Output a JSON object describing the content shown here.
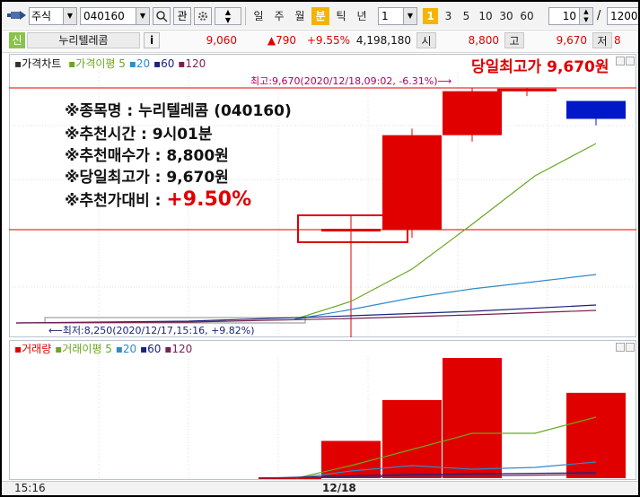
{
  "toolbar": {
    "market_select": "주식",
    "code_value": "040160",
    "fav_label": "관",
    "periods": [
      "일",
      "주",
      "월",
      "분",
      "틱",
      "년"
    ],
    "active_period": "분",
    "interval_value": "1",
    "interval_badge": "1",
    "quick_intervals": [
      "3",
      "5",
      "10",
      "30",
      "60"
    ],
    "count_value": "10",
    "slash": "/",
    "total_value": "1200"
  },
  "quote": {
    "credit_tag": "신",
    "stock_name": "누리텔레콤",
    "info_label": "i",
    "price": "9,060",
    "change": "▲790",
    "change_rate": "+9.55%",
    "volume": "4,198,180",
    "open_label": "시",
    "open_value": "8,800",
    "high_label": "고",
    "high_value": "9,670",
    "low_label": "저",
    "low_value": "8"
  },
  "price_panel": {
    "legend": {
      "title": "가격차트",
      "ma_label": "가격이평",
      "ma_periods": [
        "5",
        "20",
        "60",
        "120"
      ]
    },
    "max_note": "최고:9,670(2020/12/18,09:02, -6.31%)⟶",
    "min_note": "⟵최저:8,250(2020/12/17,15:16, +9.82%)",
    "headline": "당일최고가 9,670원",
    "annotations": [
      {
        "label": "※종목명 : ",
        "value": "누리텔레콤 (040160)"
      },
      {
        "label": "※추천시간 : ",
        "value": "9시01분"
      },
      {
        "label": "※추천매수가 : ",
        "value": "8,800원"
      },
      {
        "label": "※당일최고가 : ",
        "value": "9,670원"
      },
      {
        "label": "※추천가대비 : ",
        "value": "+9.50%"
      }
    ]
  },
  "volume_panel": {
    "legend": {
      "title": "거래량",
      "ma_label": "거래이평",
      "ma_periods": [
        "5",
        "20",
        "60",
        "120"
      ]
    }
  },
  "x_axis": {
    "labels": [
      "15:16",
      "12/18"
    ]
  },
  "chart_data": {
    "type": "candlestick",
    "candles": [
      {
        "open": 8800,
        "high": 8800,
        "low": 8800,
        "close": 8800,
        "direction": "flat"
      },
      {
        "open": 8800,
        "high": 9420,
        "low": 8750,
        "close": 9380,
        "direction": "up"
      },
      {
        "open": 9380,
        "high": 9670,
        "low": 9340,
        "close": 9650,
        "direction": "up"
      },
      {
        "open": 9650,
        "high": 9670,
        "low": 9620,
        "close": 9660,
        "direction": "up"
      },
      {
        "open": 9590,
        "high": 9590,
        "low": 9440,
        "close": 9480,
        "direction": "down"
      }
    ],
    "volumes": [
      {
        "bar": 1,
        "relative": 0.31,
        "direction": "up"
      },
      {
        "bar": 2,
        "relative": 0.65,
        "direction": "up"
      },
      {
        "bar": 3,
        "relative": 1.0,
        "direction": "up"
      },
      {
        "bar": 4,
        "relative": 0.0,
        "direction": "up"
      },
      {
        "bar": 5,
        "relative": 0.71,
        "direction": "up"
      }
    ],
    "recommended_price": 8800,
    "day_high": 9670,
    "series_colors": {
      "ma5": "#6aa621",
      "ma20": "#2f8ac8",
      "ma60": "#1a237e",
      "ma120": "#7a1f4f",
      "up": "#e00000",
      "down": "#0018c8"
    }
  }
}
